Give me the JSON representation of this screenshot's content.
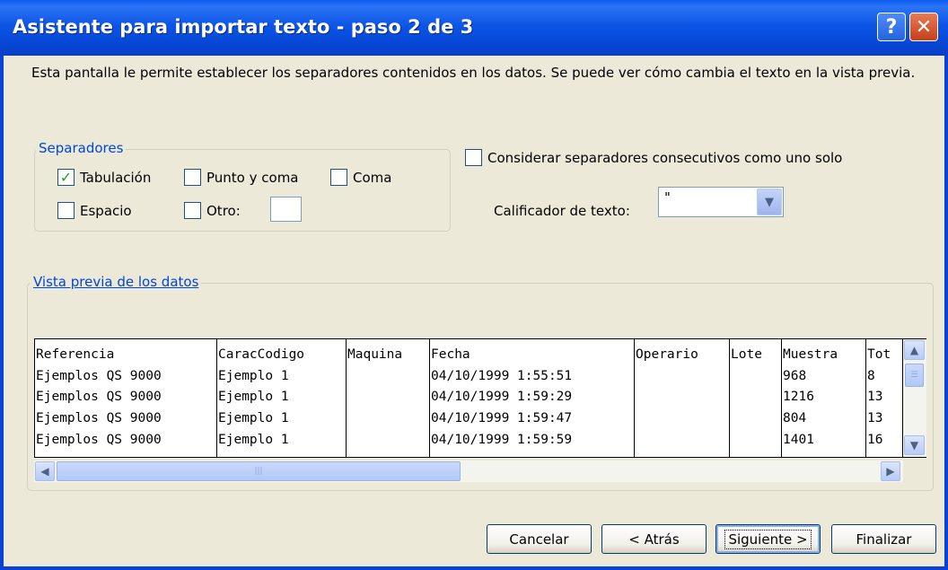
{
  "window": {
    "title": "Asistente para importar texto - paso 2 de 3",
    "help_label": "?",
    "close_label": "✕"
  },
  "description": "Esta pantalla le permite establecer los separadores contenidos en los datos. Se puede ver cómo cambia el texto en la vista previa.",
  "separators": {
    "legend": "Separadores",
    "tab": {
      "label": "Tabulación",
      "checked": true
    },
    "semicolon": {
      "label": "Punto y coma",
      "checked": false
    },
    "comma": {
      "label": "Coma",
      "checked": false
    },
    "space": {
      "label": "Espacio",
      "checked": false
    },
    "other": {
      "label": "Otro:",
      "checked": false,
      "value": ""
    }
  },
  "consecutive": {
    "label": "Considerar separadores consecutivos como uno solo",
    "checked": false
  },
  "qualifier": {
    "label": "Calificador de texto:",
    "value": "\""
  },
  "preview": {
    "legend": "Vista previa de los datos",
    "columns": [
      {
        "header": "Referencia",
        "cells": [
          "Ejemplos QS 9000",
          "Ejemplos QS 9000",
          "Ejemplos QS 9000",
          "Ejemplos QS 9000"
        ]
      },
      {
        "header": "CaracCodigo",
        "cells": [
          "Ejemplo 1",
          "Ejemplo 1",
          "Ejemplo 1",
          "Ejemplo 1"
        ]
      },
      {
        "header": "Maquina",
        "cells": [
          "",
          "",
          "",
          ""
        ]
      },
      {
        "header": "Fecha",
        "cells": [
          "04/10/1999 1:55:51",
          "04/10/1999 1:59:29",
          "04/10/1999 1:59:47",
          "04/10/1999 1:59:59"
        ]
      },
      {
        "header": "Operario",
        "cells": [
          "",
          "",
          "",
          ""
        ]
      },
      {
        "header": "Lote",
        "cells": [
          "",
          "",
          "",
          ""
        ]
      },
      {
        "header": "Muestra",
        "cells": [
          "968",
          "1216",
          "804",
          "1401"
        ]
      },
      {
        "header": "Tot",
        "cells": [
          "8",
          "13",
          "13",
          "16"
        ]
      }
    ]
  },
  "buttons": {
    "cancel": "Cancelar",
    "back": "< Atrás",
    "next": "Siguiente >",
    "finish": "Finalizar"
  },
  "icons": {
    "scroll_up": "▲",
    "scroll_down": "▼",
    "scroll_left": "◀",
    "scroll_right": "▶",
    "dropdown": "▼"
  }
}
